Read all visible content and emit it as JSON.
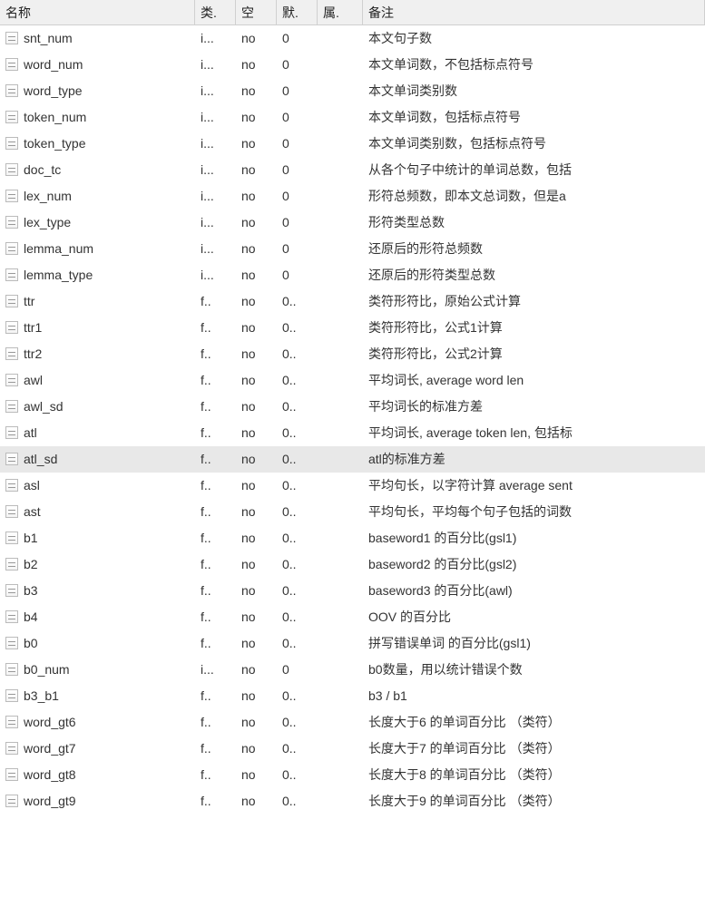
{
  "table": {
    "headers": {
      "name": "名称",
      "type": "类.",
      "null": "空",
      "default": "默.",
      "attr": "属.",
      "remark": "备注"
    },
    "rows": [
      {
        "name": "snt_num",
        "type": "i...",
        "null": "no",
        "default": "0",
        "attr": "",
        "remark": "本文句子数"
      },
      {
        "name": "word_num",
        "type": "i...",
        "null": "no",
        "default": "0",
        "attr": "",
        "remark": "本文单词数，不包括标点符号"
      },
      {
        "name": "word_type",
        "type": "i...",
        "null": "no",
        "default": "0",
        "attr": "",
        "remark": "本文单词类别数"
      },
      {
        "name": "token_num",
        "type": "i...",
        "null": "no",
        "default": "0",
        "attr": "",
        "remark": "本文单词数，包括标点符号"
      },
      {
        "name": "token_type",
        "type": "i...",
        "null": "no",
        "default": "0",
        "attr": "",
        "remark": "本文单词类别数，包括标点符号"
      },
      {
        "name": "doc_tc",
        "type": "i...",
        "null": "no",
        "default": "0",
        "attr": "",
        "remark": "从各个句子中统计的单词总数，包括"
      },
      {
        "name": "lex_num",
        "type": "i...",
        "null": "no",
        "default": "0",
        "attr": "",
        "remark": "形符总频数，即本文总词数，但是a"
      },
      {
        "name": "lex_type",
        "type": "i...",
        "null": "no",
        "default": "0",
        "attr": "",
        "remark": "形符类型总数"
      },
      {
        "name": "lemma_num",
        "type": "i...",
        "null": "no",
        "default": "0",
        "attr": "",
        "remark": "还原后的形符总频数"
      },
      {
        "name": "lemma_type",
        "type": "i...",
        "null": "no",
        "default": "0",
        "attr": "",
        "remark": "还原后的形符类型总数"
      },
      {
        "name": "ttr",
        "type": "f..",
        "null": "no",
        "default": "0..",
        "attr": "",
        "remark": "类符形符比，原始公式计算"
      },
      {
        "name": "ttr1",
        "type": "f..",
        "null": "no",
        "default": "0..",
        "attr": "",
        "remark": "类符形符比，公式1计算"
      },
      {
        "name": "ttr2",
        "type": "f..",
        "null": "no",
        "default": "0..",
        "attr": "",
        "remark": "类符形符比，公式2计算"
      },
      {
        "name": "awl",
        "type": "f..",
        "null": "no",
        "default": "0..",
        "attr": "",
        "remark": "平均词长, average word len"
      },
      {
        "name": "awl_sd",
        "type": "f..",
        "null": "no",
        "default": "0..",
        "attr": "",
        "remark": "平均词长的标准方差"
      },
      {
        "name": "atl",
        "type": "f..",
        "null": "no",
        "default": "0..",
        "attr": "",
        "remark": "平均词长, average token len, 包括标"
      },
      {
        "name": "atl_sd",
        "type": "f..",
        "null": "no",
        "default": "0..",
        "attr": "",
        "remark": "atl的标准方差",
        "selected": true
      },
      {
        "name": "asl",
        "type": "f..",
        "null": "no",
        "default": "0..",
        "attr": "",
        "remark": "平均句长，以字符计算 average sent"
      },
      {
        "name": "ast",
        "type": "f..",
        "null": "no",
        "default": "0..",
        "attr": "",
        "remark": "平均句长，平均每个句子包括的词数"
      },
      {
        "name": "b1",
        "type": "f..",
        "null": "no",
        "default": "0..",
        "attr": "",
        "remark": "baseword1 的百分比(gsl1)"
      },
      {
        "name": "b2",
        "type": "f..",
        "null": "no",
        "default": "0..",
        "attr": "",
        "remark": "baseword2 的百分比(gsl2)"
      },
      {
        "name": "b3",
        "type": "f..",
        "null": "no",
        "default": "0..",
        "attr": "",
        "remark": "baseword3 的百分比(awl)"
      },
      {
        "name": "b4",
        "type": "f..",
        "null": "no",
        "default": "0..",
        "attr": "",
        "remark": "OOV 的百分比"
      },
      {
        "name": "b0",
        "type": "f..",
        "null": "no",
        "default": "0..",
        "attr": "",
        "remark": "拼写错误单词 的百分比(gsl1)"
      },
      {
        "name": "b0_num",
        "type": "i...",
        "null": "no",
        "default": "0",
        "attr": "",
        "remark": "b0数量，用以统计错误个数"
      },
      {
        "name": "b3_b1",
        "type": "f..",
        "null": "no",
        "default": "0..",
        "attr": "",
        "remark": "b3 / b1"
      },
      {
        "name": "word_gt6",
        "type": "f..",
        "null": "no",
        "default": "0..",
        "attr": "",
        "remark": "长度大于6 的单词百分比 （类符）"
      },
      {
        "name": "word_gt7",
        "type": "f..",
        "null": "no",
        "default": "0..",
        "attr": "",
        "remark": "长度大于7 的单词百分比 （类符）"
      },
      {
        "name": "word_gt8",
        "type": "f..",
        "null": "no",
        "default": "0..",
        "attr": "",
        "remark": "长度大于8 的单词百分比 （类符）"
      },
      {
        "name": "word_gt9",
        "type": "f..",
        "null": "no",
        "default": "0..",
        "attr": "",
        "remark": "长度大于9 的单词百分比 （类符）"
      }
    ]
  }
}
